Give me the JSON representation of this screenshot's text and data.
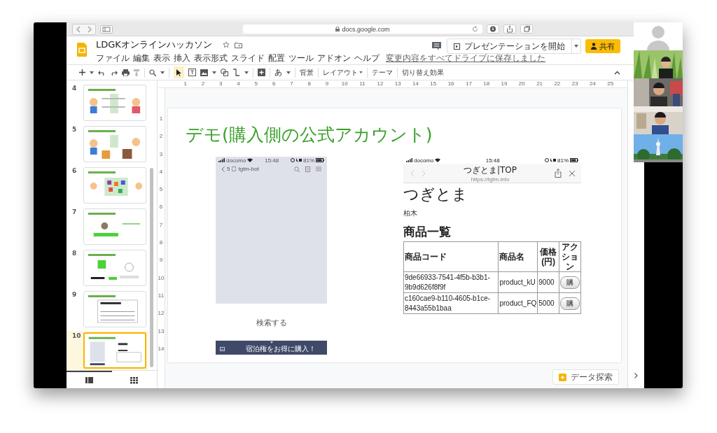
{
  "browser": {
    "address": "docs.google.com"
  },
  "document": {
    "title": "LDGKオンラインハッカソン",
    "menus": [
      "ファイル",
      "編集",
      "表示",
      "挿入",
      "表示形式",
      "スライド",
      "配置",
      "ツール",
      "アドオン",
      "ヘルプ"
    ],
    "save_status": "変更内容をすべてドライブに保存しました"
  },
  "header_buttons": {
    "present": "プレゼンテーションを開始",
    "share": "共有"
  },
  "toolbar": {
    "select_tool_selected": true,
    "input_tool": "あ",
    "text_buttons": [
      {
        "label": "背景",
        "dropdown": false
      },
      {
        "label": "レイアウト",
        "dropdown": true
      },
      {
        "label": "テーマ",
        "dropdown": false
      },
      {
        "label": "切り替え効果",
        "dropdown": false
      }
    ]
  },
  "rulers": {
    "horizontal": [
      "1",
      "2",
      "3",
      "4",
      "5",
      "6",
      "7",
      "8",
      "9",
      "10",
      "11",
      "12",
      "13",
      "14",
      "15",
      "16",
      "17",
      "18",
      "19",
      "20",
      "21",
      "22",
      "23",
      "24",
      "25"
    ],
    "vertical": [
      "1",
      "2",
      "3",
      "4",
      "5",
      "6",
      "7",
      "8",
      "9",
      "10",
      "11",
      "12",
      "13",
      "14"
    ]
  },
  "filmstrip": {
    "slides": [
      {
        "number": "4",
        "selected": false
      },
      {
        "number": "5",
        "selected": false
      },
      {
        "number": "6",
        "selected": false
      },
      {
        "number": "7",
        "selected": false
      },
      {
        "number": "8",
        "selected": false
      },
      {
        "number": "9",
        "selected": false
      },
      {
        "number": "10",
        "selected": true
      }
    ],
    "view_toggles": [
      {
        "selected": true
      },
      {
        "selected": false
      }
    ]
  },
  "slide": {
    "title": "デモ(購入側の公式アカウント)",
    "left_phone": {
      "carrier": "docomo",
      "time": "15:48",
      "battery": "81%",
      "back_count": "5",
      "chat_name": "tgtm-bot",
      "input_label": "検索する",
      "menu_label": "宿泊権をお得に購入！"
    },
    "right_phone": {
      "carrier": "docomo",
      "time": "15:48",
      "battery": "81%",
      "page_title": "つぎとま|TOP",
      "url": "https://tgtm.info",
      "heading": "つぎとま",
      "author": "柏木",
      "section_heading": "商品一覧",
      "table": {
        "columns": [
          "商品コード",
          "商品名",
          "価格(円)",
          "アクション"
        ],
        "rows": [
          {
            "code": "9de66933-7541-4f5b-b3b1-9b9d626f8f9f",
            "name": "product_kU",
            "price": "9000",
            "action": "購"
          },
          {
            "code": "c160cae9-b110-4605-b1ce-8443a55b1baa",
            "name": "product_FQ",
            "price": "5000",
            "action": "購"
          }
        ]
      }
    }
  },
  "explore_button": "データ探索",
  "video_tiles": [
    {
      "kind": "avatar"
    },
    {
      "kind": "picture"
    },
    {
      "kind": "picture"
    },
    {
      "kind": "picture"
    },
    {
      "kind": "picture"
    }
  ]
}
